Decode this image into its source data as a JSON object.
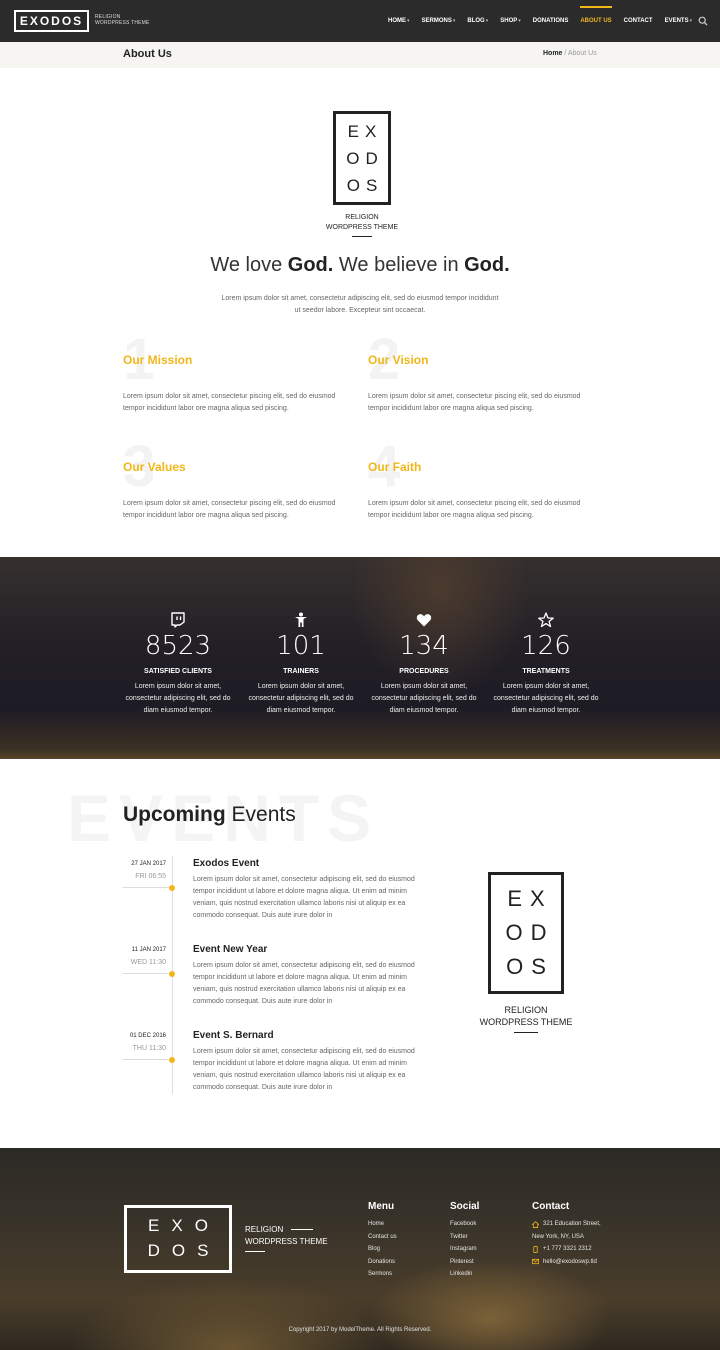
{
  "header": {
    "logo": "EXODOS",
    "logo_tag_line1": "RELIGION",
    "logo_tag_line2": "WORDPRESS THEME",
    "nav": [
      {
        "label": "HOME",
        "dropdown": true
      },
      {
        "label": "SERMONS",
        "dropdown": true
      },
      {
        "label": "BLOG",
        "dropdown": true
      },
      {
        "label": "SHOP",
        "dropdown": true
      },
      {
        "label": "DONATIONS",
        "dropdown": false
      },
      {
        "label": "ABOUT US",
        "dropdown": false,
        "active": true
      },
      {
        "label": "CONTACT",
        "dropdown": false
      },
      {
        "label": "EVENTS",
        "dropdown": true
      }
    ],
    "search_icon": "search-icon"
  },
  "breadcrumb": {
    "page_title": "About Us",
    "home": "Home",
    "separator": "/",
    "current": "About Us"
  },
  "intro": {
    "logo_rows": [
      "EX",
      "OD",
      "OS"
    ],
    "tag_line1": "RELIGION",
    "tag_line2": "WORDPRESS THEME",
    "headline_1": "We love ",
    "headline_2": "God.",
    "headline_3": " We believe in ",
    "headline_4": "God.",
    "text": "Lorem ipsum dolor sit amet, consectetur adipiscing elit, sed do eiusmod tempor incididunt ut seedor labore. Excepteur sint occaecat."
  },
  "values": [
    {
      "num": "1",
      "title": "Our Mission",
      "text": "Lorem ipsum dolor sit amet, consectetur piscing elit, sed do eiusmod tempor incididunt labor ore magna aliqua sed piscing."
    },
    {
      "num": "2",
      "title": "Our Vision",
      "text": "Lorem ipsum dolor sit amet, consectetur piscing elit, sed do eiusmod tempor incididunt labor ore magna aliqua sed piscing."
    },
    {
      "num": "3",
      "title": "Our Values",
      "text": "Lorem ipsum dolor sit amet, consectetur piscing elit, sed do eiusmod tempor incididunt labor ore magna aliqua sed piscing."
    },
    {
      "num": "4",
      "title": "Our Faith",
      "text": "Lorem ipsum dolor sit amet, consectetur piscing elit, sed do eiusmod tempor incididunt labor ore magna aliqua sed piscing."
    }
  ],
  "stats": [
    {
      "icon": "twitch-icon",
      "value": "8523",
      "label": "SATISFIED CLIENTS",
      "text": "Lorem ipsum dolor sit amet, consectetur adipiscing elit, sed do diam eiusmod tempor."
    },
    {
      "icon": "person-icon",
      "value": "101",
      "label": "TRAINERS",
      "text": "Lorem ipsum dolor sit amet, consectetur adipiscing elit, sed do diam eiusmod tempor."
    },
    {
      "icon": "heart-icon",
      "value": "134",
      "label": "PROCEDURES",
      "text": "Lorem ipsum dolor sit amet, consectetur adipiscing elit, sed do diam eiusmod tempor."
    },
    {
      "icon": "star-icon",
      "value": "126",
      "label": "TREATMENTS",
      "text": "Lorem ipsum dolor sit amet, consectetur adipiscing elit, sed do diam eiusmod tempor."
    }
  ],
  "events": {
    "bg_word": "EVENTS",
    "title_bold": "Upcoming",
    "title_light": " Events",
    "items": [
      {
        "date": "27 JAN 2017",
        "day": "FRI 06:55",
        "title": "Exodos Event",
        "text": "Lorem ipsum dolor sit amet, consectetur adipiscing elit, sed do eiusmod tempor incididunt ut labore et dolore magna aliqua. Ut enim ad minim veniam, quis nostrud exercitation ullamco laboris nisi ut aliquip ex ea commodo consequat. Duis aute irure dolor in"
      },
      {
        "date": "11 JAN 2017",
        "day": "WED 11:30",
        "title": "Event New Year",
        "text": "Lorem ipsum dolor sit amet, consectetur adipiscing elit, sed do eiusmod tempor incididunt ut labore et dolore magna aliqua. Ut enim ad minim veniam, quis nostrud exercitation ullamco laboris nisi ut aliquip ex ea commodo consequat. Duis aute irure dolor in"
      },
      {
        "date": "01 DEC 2016",
        "day": "THU 11:30",
        "title": "Event S. Bernard",
        "text": "Lorem ipsum dolor sit amet, consectetur adipiscing elit, sed do eiusmod tempor incididunt ut labore et dolore magna aliqua. Ut enim ad minim veniam, quis nostrud exercitation ullamco laboris nisi ut aliquip ex ea commodo consequat. Duis aute irure dolor in"
      }
    ],
    "side_logo_rows": [
      "EX",
      "OD",
      "OS"
    ],
    "side_tag_line1": "RELIGION",
    "side_tag_line2": "WORDPRESS THEME"
  },
  "footer": {
    "logo_rows": [
      "EXO",
      "DOS"
    ],
    "tag_line1": "RELIGION",
    "tag_line2": "WORDPRESS THEME",
    "menu": {
      "title": "Menu",
      "links": [
        "Home",
        "Contact us",
        "Blog",
        "Donations",
        "Sermons"
      ]
    },
    "social": {
      "title": "Social",
      "links": [
        "Facebook",
        "Twitter",
        "Instagram",
        "Pinterest",
        "Linkedin"
      ]
    },
    "contact": {
      "title": "Contact",
      "address_line1": "321 Education Street,",
      "address_line2": "New York, NY, USA",
      "phone": "+1 777 3321 2312",
      "email": "hello@exodoswp.tld"
    },
    "copyright": "Copyright 2017 by ModelTheme. All Rights Reserved."
  },
  "colors": {
    "accent": "#f1b719",
    "dark": "#2b2b2b",
    "text": "#666666"
  }
}
